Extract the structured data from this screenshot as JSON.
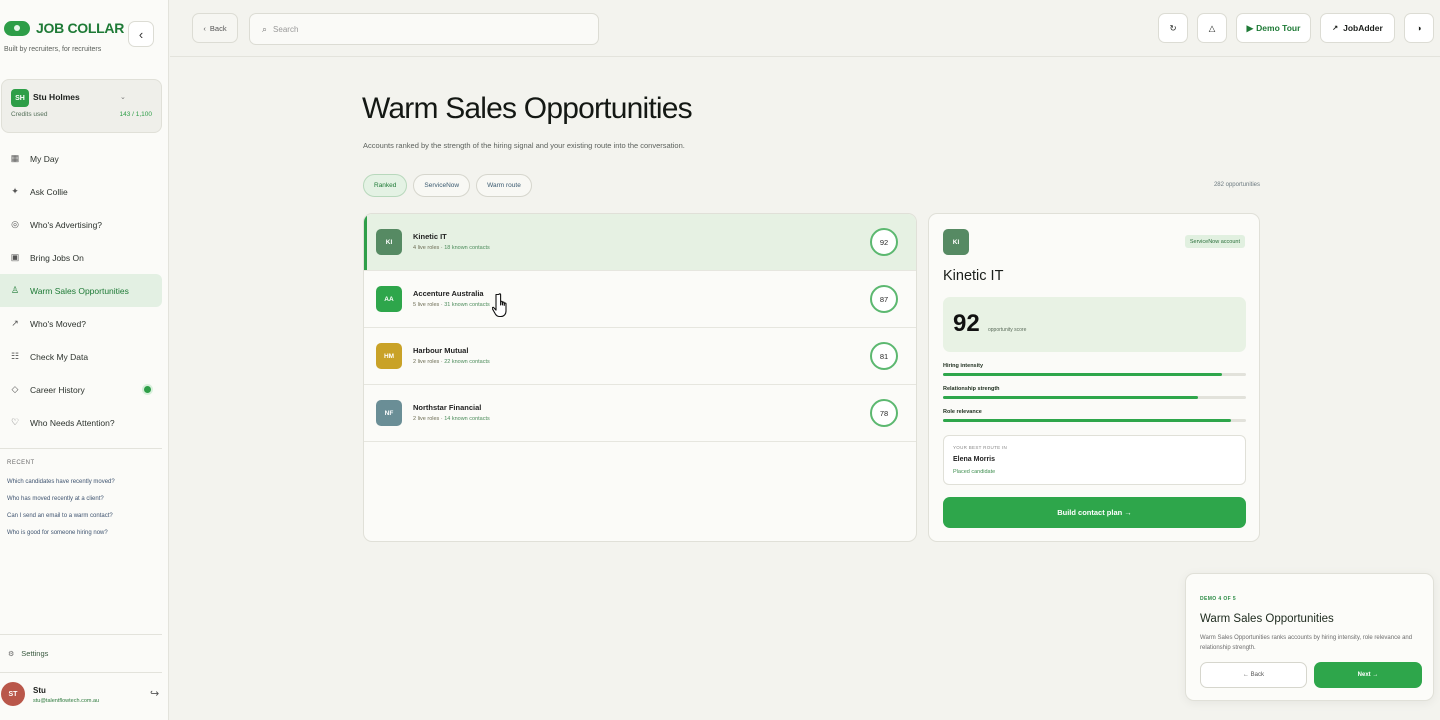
{
  "app": {
    "logo_text": "JOB COLLAR",
    "tagline": "Built by recruiters, for recruiters",
    "collapse_icon": "chevron-left-icon"
  },
  "user_card": {
    "initials": "SH",
    "name": "Stu Holmes",
    "credits_label": "Credits used",
    "credits_value": "143 / 1,100"
  },
  "nav": {
    "items": [
      {
        "label": "My Day",
        "icon": "calendar-grid-icon",
        "glyph": "▦",
        "active": false
      },
      {
        "label": "Ask Collie",
        "icon": "sparkle-icon",
        "glyph": "✦",
        "active": false
      },
      {
        "label": "Who's Advertising?",
        "icon": "target-icon",
        "glyph": "◎",
        "active": false
      },
      {
        "label": "Bring Jobs On",
        "icon": "briefcase-icon",
        "glyph": "▣",
        "active": false
      },
      {
        "label": "Warm Sales Opportunities",
        "icon": "person-icon",
        "glyph": "♙",
        "active": true
      },
      {
        "label": "Who's Moved?",
        "icon": "arrow-up-right-icon",
        "glyph": "↗",
        "active": false
      },
      {
        "label": "Check My Data",
        "icon": "database-icon",
        "glyph": "☷",
        "active": false
      },
      {
        "label": "Career History",
        "icon": "diamond-icon",
        "glyph": "◇",
        "active": false
      },
      {
        "label": "Who Needs Attention?",
        "icon": "heart-icon",
        "glyph": "♡",
        "active": false
      }
    ]
  },
  "recent": {
    "title": "RECENT",
    "items": [
      "Which candidates have recently moved?",
      "Who has moved recently at a client?",
      "Can I send an email to a warm contact?",
      "Who is good for someone hiring now?"
    ]
  },
  "settings_label": "Settings",
  "footer_user": {
    "initials": "ST",
    "name": "Stu",
    "email": "stu@talentflowtech.com.au"
  },
  "topbar": {
    "back_label": "Back",
    "search_placeholder": "Search",
    "demo_tour_label": "Demo Tour",
    "jobadder_label": "JobAdder"
  },
  "main": {
    "title": "Warm Sales Opportunities",
    "subtitle": "Accounts ranked by the strength of the hiring signal and your existing route into the conversation.",
    "filters": [
      {
        "label": "Ranked",
        "active": true
      },
      {
        "label": "ServiceNow",
        "active": false
      },
      {
        "label": "Warm route",
        "active": false
      }
    ],
    "opportunity_count": "282 opportunities"
  },
  "accounts": [
    {
      "initials": "KI",
      "name": "Kinetic IT",
      "roles": "4 live roles",
      "contacts": "18 known contacts",
      "score": "92",
      "color": "#568a63",
      "selected": true
    },
    {
      "initials": "AA",
      "name": "Accenture Australia",
      "roles": "5 live roles",
      "contacts": "31 known contacts",
      "score": "87",
      "color": "#2ea64b",
      "selected": false
    },
    {
      "initials": "HM",
      "name": "Harbour Mutual",
      "roles": "2 live roles",
      "contacts": "22 known contacts",
      "score": "81",
      "color": "#c9a227",
      "selected": false
    },
    {
      "initials": "NF",
      "name": "Northstar Financial",
      "roles": "2 live roles",
      "contacts": "14 known contacts",
      "score": "78",
      "color": "#6a8e96",
      "selected": false
    }
  ],
  "detail": {
    "initials": "KI",
    "badge": "ServiceNow account",
    "name": "Kinetic IT",
    "score": "92",
    "score_label": "opportunity score",
    "metrics": [
      {
        "label": "Hiring intensity",
        "value": 0.92
      },
      {
        "label": "Relationship strength",
        "value": 0.84
      },
      {
        "label": "Role relevance",
        "value": 0.95
      }
    ],
    "route_label": "YOUR BEST ROUTE IN",
    "route_name": "Elena Morris",
    "route_sub": "Placed candidate",
    "build_label": "Build contact plan →"
  },
  "tour": {
    "step": "DEMO 4 OF 5",
    "title": "Warm Sales Opportunities",
    "text": "Warm Sales Opportunities ranks accounts by hiring intensity, role relevance and relationship strength.",
    "back_label": "← Back",
    "next_label": "Next →"
  }
}
